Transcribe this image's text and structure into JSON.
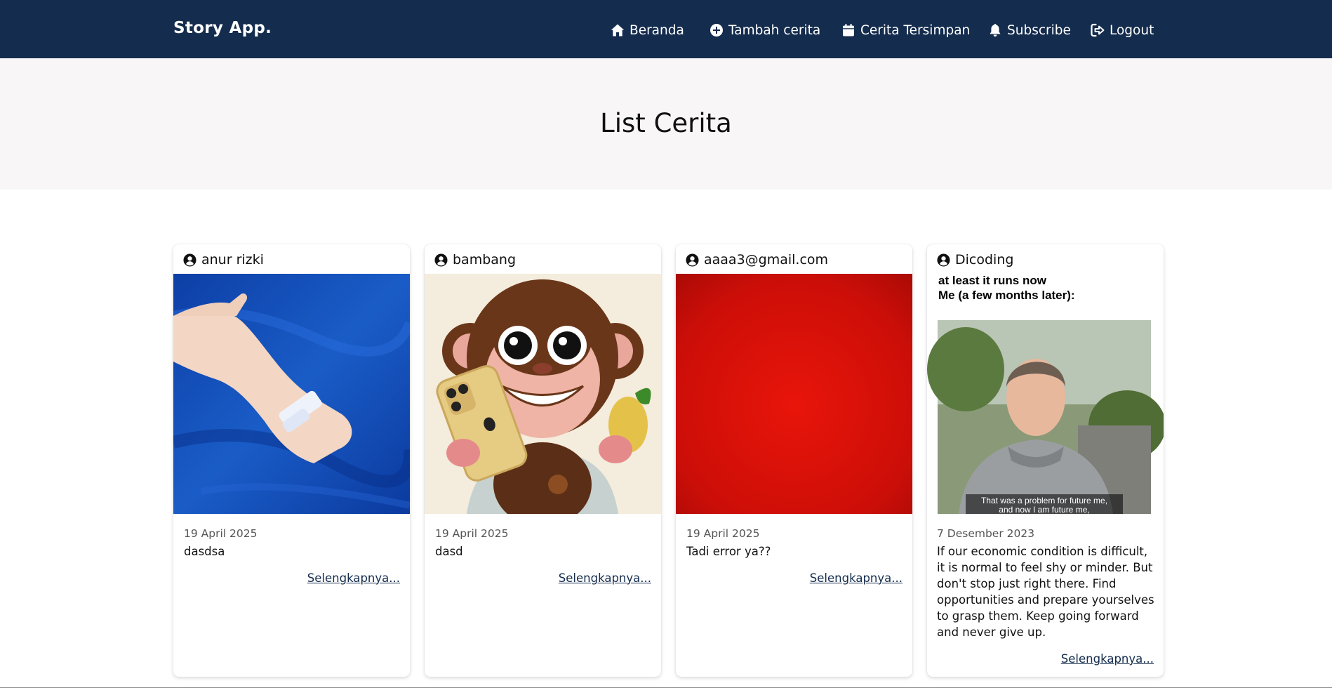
{
  "navbar": {
    "brand": "Story App.",
    "items": [
      {
        "label": "Beranda",
        "icon": "home-icon"
      },
      {
        "label": "Tambah cerita",
        "icon": "plus-circle-icon"
      },
      {
        "label": "Cerita Tersimpan",
        "icon": "calendar-icon"
      },
      {
        "label": "Subscribe",
        "icon": "bell-icon"
      },
      {
        "label": "Logout",
        "icon": "logout-icon"
      }
    ]
  },
  "hero": {
    "title": "List Cerita"
  },
  "stories": [
    {
      "author": "anur rizki",
      "date": "19 April 2025",
      "description": "dasdsa",
      "link": "Selengkapnya..."
    },
    {
      "author": "bambang",
      "date": "19 April 2025",
      "description": "dasd",
      "link": "Selengkapnya..."
    },
    {
      "author": "aaaa3@gmail.com",
      "date": "19 April 2025",
      "description": "Tadi error ya??",
      "link": "Selengkapnya..."
    },
    {
      "author": "Dicoding",
      "image_text": {
        "line1": "at least it runs now",
        "line2": "Me (a few months later):",
        "caption1": "That was a problem for future me,",
        "caption2": "and now I am future me,"
      },
      "date": "7 Desember 2023",
      "description": "If our economic condition is difficult, it is normal to feel shy or minder. But don't stop just right there. Find opportunities and prepare yourselves to grasp them. Keep going forward and never give up.",
      "link": "Selengkapnya..."
    }
  ],
  "colors": {
    "navbar": "#142c4d",
    "hero": "#f8f6f7",
    "link": "#142c4d"
  }
}
